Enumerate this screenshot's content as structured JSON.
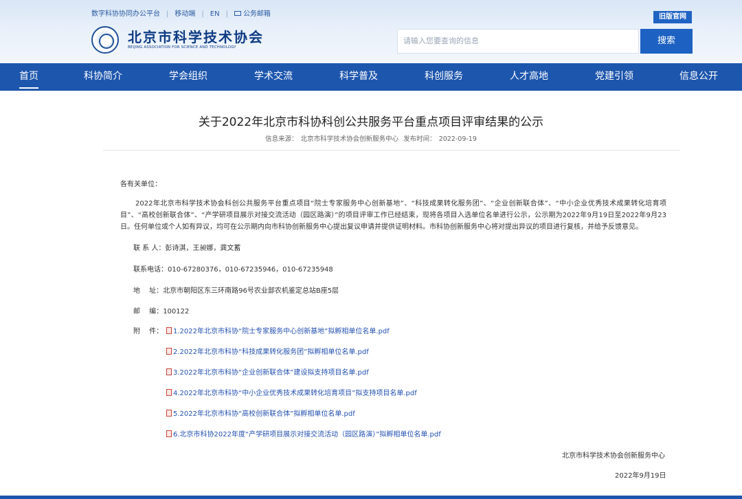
{
  "header": {
    "top_links": [
      "数字科协协同办公平台",
      "移动端",
      "EN",
      "公务邮箱"
    ],
    "logo_cn": "北京市科学技术协会",
    "logo_en": "BEIJING ASSOCIATION FOR SCIENCE AND TECHNOLOGY",
    "old_site": "旧版官网",
    "search_placeholder": "请输入您要查询的信息",
    "search_button": "搜索"
  },
  "nav": {
    "items": [
      "首页",
      "科协简介",
      "学会组织",
      "学术交流",
      "科学普及",
      "科创服务",
      "人才高地",
      "党建引领",
      "信息公开"
    ],
    "active": "首页"
  },
  "article": {
    "title": "关于2022年北京市科协科创公共服务平台重点项目评审结果的公示",
    "source_label": "信息来源：",
    "source": "北京市科学技术协会创新服务中心",
    "date_label": "发布时间：",
    "date": "2022-09-19",
    "greeting": "各有关单位：",
    "body": "2022年北京市科学技术协会科创公共服务平台重点项目“院士专家服务中心创新基地”、“科技成果转化服务团”、“企业创新联合体”、“中小企业优秀技术成果转化培育项目”、“高校创新联合体”、“产学研项目展示对接交流活动（园区路演）”的项目评审工作已经结束，现将各项目入选单位名单进行公示，公示期为2022年9月19日至2022年9月23日。任何单位或个人如有异议，均可在公示期内向市科协创新服务中心提出复议申请并提供证明材料。市科协创新服务中心将对提出异议的项目进行复核，并给予反馈意见。",
    "contact_label": "联 系 人：",
    "contact": "彭诗淇，王昶娜，龚文蓄",
    "phone_label": "联系电话：",
    "phone": "010-67280376，010-67235946，010-67235948",
    "address_label": "地　 址：",
    "address": "北京市朝阳区东三环南路96号农业部农机鉴定总站B座5层",
    "postcode_label": "邮　 编：",
    "postcode": "100122",
    "attachments_label": "附　 件：",
    "attachments": [
      "1.2022年北京市科协“院士专家服务中心创新基地”拟孵相单位名单.pdf",
      "2.2022年北京市科协“科技成果转化服务团”拟孵相单位名单.pdf",
      "3.2022年北京市科协“企业创新联合体”建设拟支持项目名单.pdf",
      "4.2022年北京市科协“中小企业优秀技术成果转化培育项目”拟支持项目名单.pdf",
      "5.2022年北京市科协“高校创新联合体”拟孵相单位名单.pdf",
      "6.北京市科协2022年度“产学研项目展示对接交流活动（园区路演）”拟孵相单位名单.pdf"
    ],
    "signature_org": "北京市科学技术协会创新服务中心",
    "signature_date": "2022年9月19日"
  }
}
